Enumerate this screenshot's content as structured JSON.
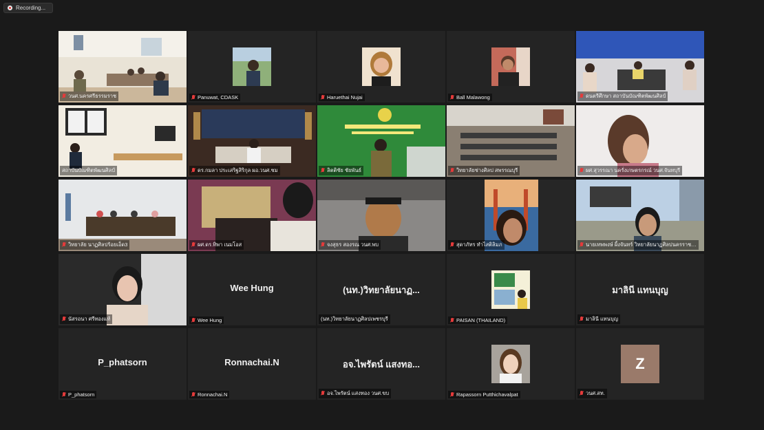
{
  "recording": {
    "label": "Recording..."
  },
  "tiles": [
    {
      "name": "วนศ.นครศรีธรรมราช"
    },
    {
      "name": "Panuwat, CDASK"
    },
    {
      "name": "Haruethai Nujai"
    },
    {
      "name": "Ball Malawong"
    },
    {
      "name": "ดนตรีศึกษา สถาบันบัณฑิตพัฒนศิลป์"
    },
    {
      "name": "สถาบันบัณฑิตพัฒนศิลป์"
    },
    {
      "name": "ดร.กมลา ประเสริฐสิริกุล ผอ.วนศ.ชม"
    },
    {
      "name": "ลิตติชัย ชัยพันธ์"
    },
    {
      "name": "วิทยาลัยช่างศิลป สพรรณบุรี"
    },
    {
      "name": "ผศ.สุวรรณา นครั่งเกษตรกรณ์ วนศ.จันทบุรี"
    },
    {
      "name": "วิทยาลัย นาฏศิลปร้อยเอ็ด3"
    },
    {
      "name": "ผศ.ดร.ทิพา เนมโอส"
    },
    {
      "name": "จงสุธร สองรณ วนศ.พบ"
    },
    {
      "name": "สุดาภัทร ทำไสติลิมภ"
    },
    {
      "name": "นายเทพพงษ์ ผิ้งจันทร์ วิทยาลัยนาฏศิลปนครราชสีมา"
    },
    {
      "name": "นัสรอนา ศรีทองแท้"
    },
    {
      "name": "Wee Hung",
      "big": "Wee Hung"
    },
    {
      "name": "(นท.)วิทยาลัยนาฏศิลปเพชรบุรี",
      "big": "(นท.)วิทยาลัยนาฏ..."
    },
    {
      "name": "PAISAN (THAILAND)"
    },
    {
      "name": "มาลินี แทนบุญ",
      "big": "มาลินี แทนบุญ"
    },
    {
      "name": "P_phatsorn",
      "big": "P_phatsorn"
    },
    {
      "name": "Ronnachai.N",
      "big": "Ronnachai.N"
    },
    {
      "name": "อจ.ไพรัตน์ แสงทอง วนศ.ขบ",
      "big": "อจ.ไพรัตน์ แสงทอ..."
    },
    {
      "name": "Rapassorn Putthichavalpat"
    },
    {
      "name": "วนศ.สท.",
      "letter": "Z"
    }
  ],
  "colors": {
    "background": "#1a1a1a",
    "tile": "#242424",
    "active_outline": "#d9c94a",
    "muted": "#e43b3b"
  }
}
